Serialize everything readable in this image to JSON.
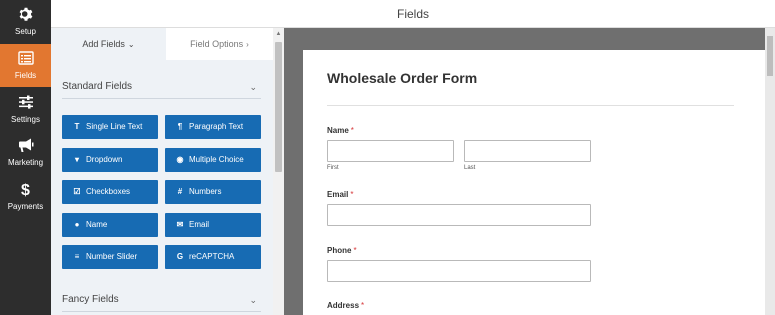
{
  "window": {
    "title": "Fields"
  },
  "nav": {
    "setup": "Setup",
    "fields": "Fields",
    "settings": "Settings",
    "marketing": "Marketing",
    "payments": "Payments"
  },
  "tabs": {
    "add_fields": "Add Fields",
    "field_options": "Field Options"
  },
  "sections": {
    "standard": "Standard Fields",
    "fancy": "Fancy Fields"
  },
  "standard_fields": [
    {
      "label": "Single Line Text",
      "icon": "T"
    },
    {
      "label": "Paragraph Text",
      "icon": "¶"
    },
    {
      "label": "Dropdown",
      "icon": "▾"
    },
    {
      "label": "Multiple Choice",
      "icon": "◉"
    },
    {
      "label": "Checkboxes",
      "icon": "☑"
    },
    {
      "label": "Numbers",
      "icon": "#"
    },
    {
      "label": "Name",
      "icon": "●"
    },
    {
      "label": "Email",
      "icon": "✉"
    },
    {
      "label": "Number Slider",
      "icon": "≡"
    },
    {
      "label": "reCAPTCHA",
      "icon": "G"
    }
  ],
  "form": {
    "title": "Wholesale Order Form",
    "name_label": "Name",
    "first_sublabel": "First",
    "last_sublabel": "Last",
    "email_label": "Email",
    "phone_label": "Phone",
    "address_label": "Address",
    "required_mark": "*"
  },
  "colors": {
    "sidebar_bg": "#2d2d2d",
    "active_accent": "#e27730",
    "button_blue": "#176bb3",
    "panel_bg": "#eef2f6",
    "preview_bg": "#6f6f6f",
    "required_red": "#d63638"
  }
}
